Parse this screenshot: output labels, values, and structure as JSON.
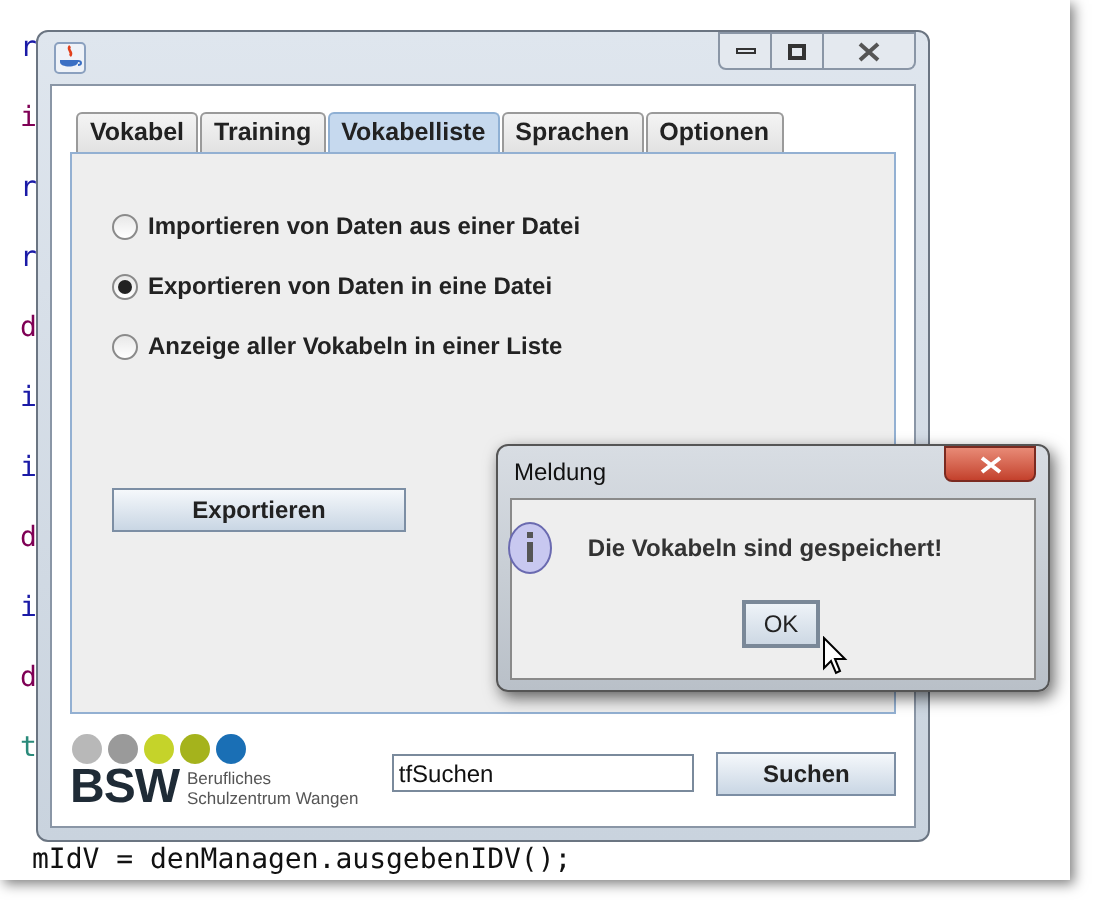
{
  "background_code": {
    "lines": [
      {
        "text": "r",
        "color": "#1a1aa6"
      },
      {
        "text": "i",
        "color": "#7f0055"
      },
      {
        "text": "r",
        "color": "#1a1aa6"
      },
      {
        "text": "r",
        "color": "#1a1aa6"
      },
      {
        "text": "d",
        "color": "#7f0055"
      },
      {
        "text": "i",
        "color": "#1a1aa6"
      },
      {
        "text": "i",
        "color": "#1a1aa6"
      },
      {
        "text": "d",
        "color": "#7f0055"
      },
      {
        "text": "i",
        "color": "#1a1aa6"
      },
      {
        "text": "d",
        "color": "#7f0055"
      },
      {
        "text": "t",
        "color": "#2a8a7a"
      }
    ],
    "last_line": "mIdV = denManagen.ausgebenIDV();"
  },
  "main_window": {
    "tabs": [
      {
        "label": "Vokabel",
        "selected": false
      },
      {
        "label": "Training",
        "selected": false
      },
      {
        "label": "Vokabelliste",
        "selected": true
      },
      {
        "label": "Sprachen",
        "selected": false
      },
      {
        "label": "Optionen",
        "selected": false
      }
    ],
    "options": [
      {
        "label": "Importieren von Daten aus einer Datei",
        "selected": false
      },
      {
        "label": "Exportieren von Daten in eine Datei",
        "selected": true
      },
      {
        "label": "Anzeige aller Vokabeln in einer Liste",
        "selected": false
      }
    ],
    "action_button": "Exportieren",
    "logo": {
      "wordmark": "BSW",
      "line_1": "Berufliches",
      "line_2": "Schulzentrum Wangen",
      "dots": [
        {
          "color": "#b8b8b8"
        },
        {
          "color": "#9a9a9a"
        },
        {
          "color": "#c5d32a"
        },
        {
          "color": "#a5b31c"
        },
        {
          "color": "#1a6fb5"
        }
      ]
    },
    "search": {
      "value": "tfSuchen",
      "button": "Suchen"
    }
  },
  "dialog": {
    "title": "Meldung",
    "message": "Die Vokabeln sind gespeichert!",
    "button": "OK"
  }
}
